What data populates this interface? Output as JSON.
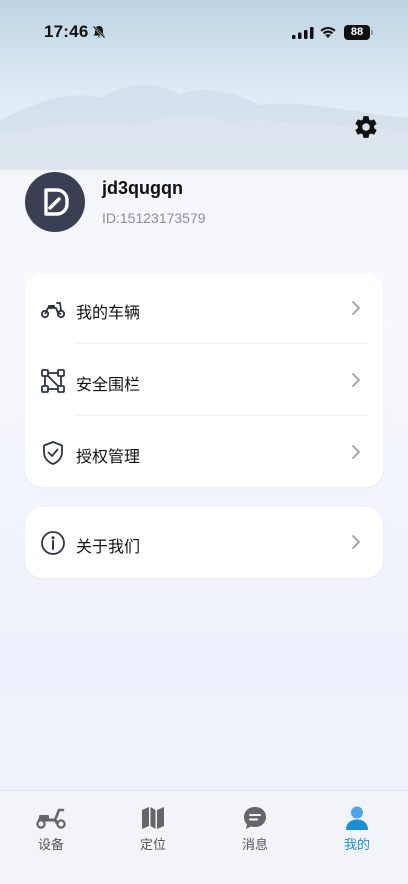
{
  "status_bar": {
    "time": "17:46",
    "battery": "88"
  },
  "profile": {
    "username": "jd3qugqn",
    "id_text": "ID:15123173579"
  },
  "menu_group_1": [
    {
      "label": "我的车辆",
      "icon": "scooter-icon"
    },
    {
      "label": "安全围栏",
      "icon": "fence-icon"
    },
    {
      "label": "授权管理",
      "icon": "shield-check-icon"
    }
  ],
  "menu_group_2": [
    {
      "label": "关于我们",
      "icon": "info-icon"
    }
  ],
  "tabbar": {
    "tabs": [
      {
        "label": "设备",
        "icon": "scooter-icon",
        "active": false
      },
      {
        "label": "定位",
        "icon": "map-icon",
        "active": false
      },
      {
        "label": "消息",
        "icon": "message-icon",
        "active": false
      },
      {
        "label": "我的",
        "icon": "person-icon",
        "active": true
      }
    ]
  },
  "colors": {
    "accent": "#1b8fd6",
    "avatar_bg": "#3b3f54",
    "icon_dark": "#2f3447"
  }
}
